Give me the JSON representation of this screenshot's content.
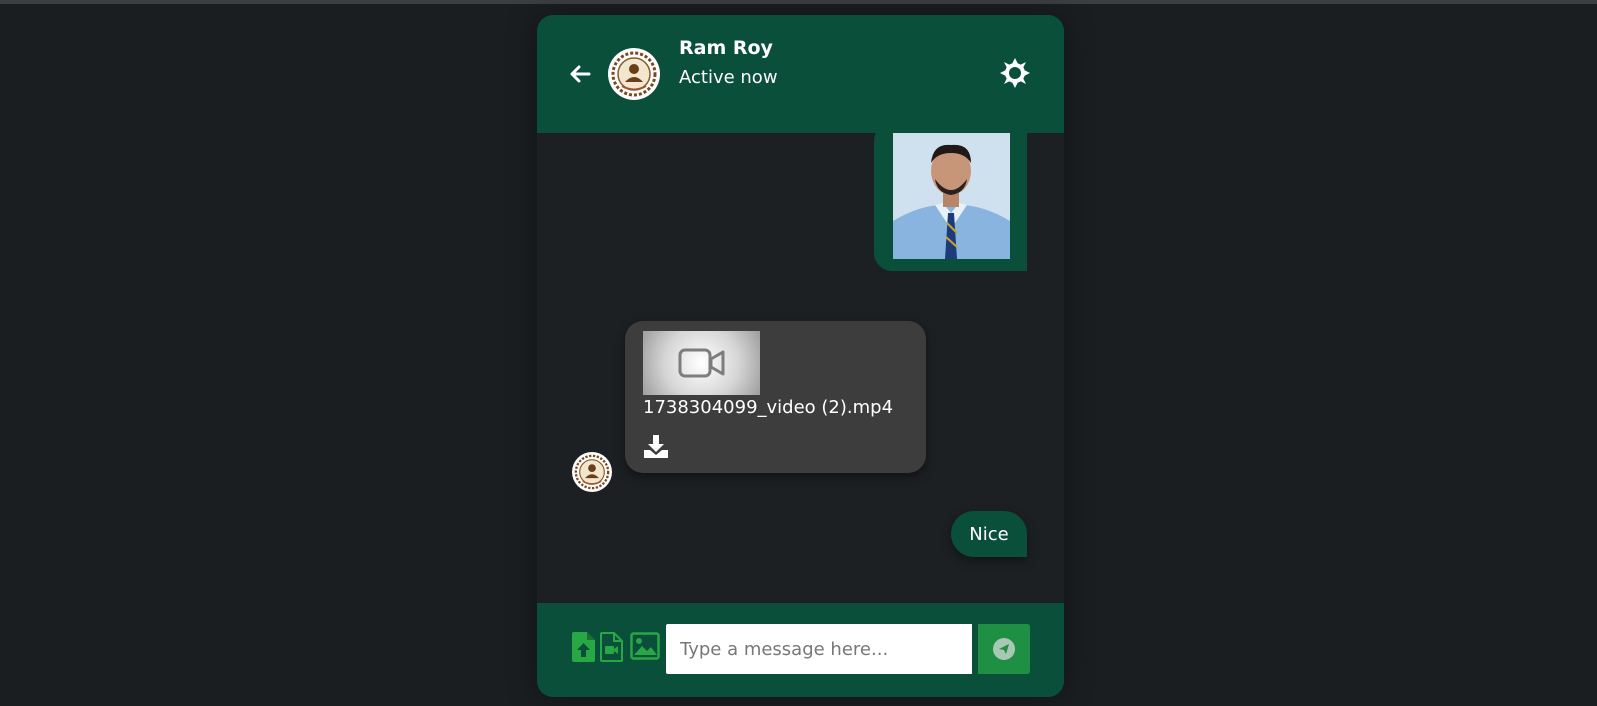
{
  "colors": {
    "page_background": "#1b1e21",
    "header_green": "#0a4f3a",
    "accent_green": "#1f8f44",
    "received_bubble": "#3d3d3d"
  },
  "header": {
    "contact_name": "Ram Roy",
    "status": "Active now",
    "icons": [
      "arrow-left-icon",
      "avatar",
      "sun-settings-icon"
    ]
  },
  "messages": [
    {
      "type": "image",
      "direction": "sent"
    },
    {
      "type": "file",
      "direction": "received",
      "file_name": "1738304099_video (2).mp4",
      "icons": [
        "video-camera-icon",
        "download-icon"
      ]
    },
    {
      "type": "text",
      "direction": "sent",
      "text": "Nice"
    }
  ],
  "composer": {
    "placeholder": "Type a message here...",
    "icons": [
      "file-upload-icon",
      "file-video-icon",
      "image-icon",
      "send-icon"
    ]
  }
}
